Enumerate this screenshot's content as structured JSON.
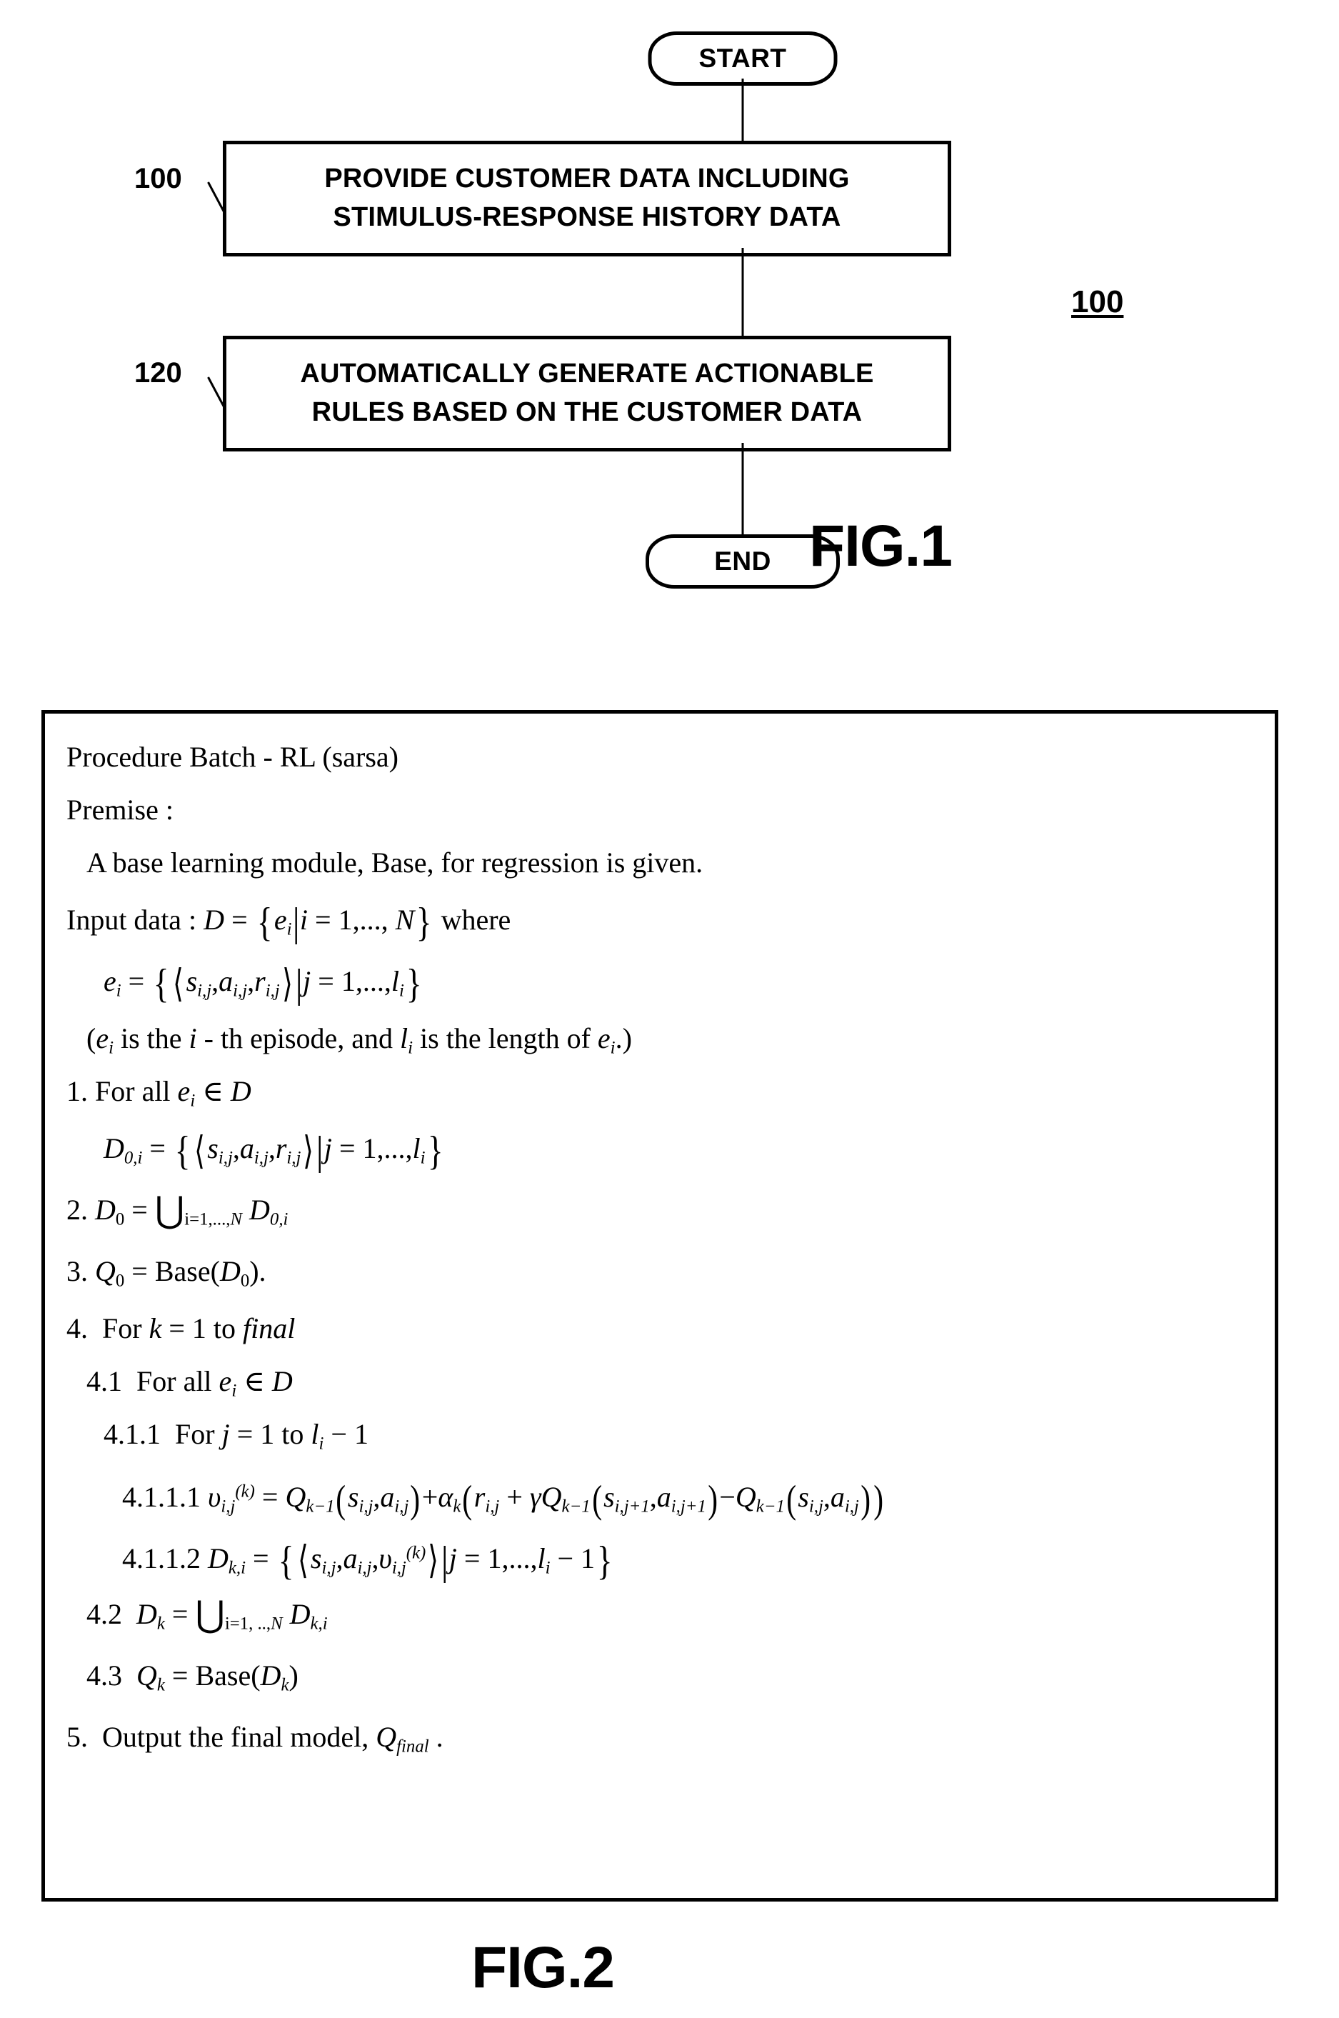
{
  "figure1": {
    "caption": "FIG.1",
    "overall_ref": "100",
    "start_terminal": "START",
    "end_terminal": "END",
    "steps": [
      {
        "ref": "100",
        "line1": "PROVIDE CUSTOMER DATA INCLUDING",
        "line2": "STIMULUS-RESPONSE HISTORY DATA"
      },
      {
        "ref": "120",
        "line1": "AUTOMATICALLY GENERATE ACTIONABLE",
        "line2": "RULES BASED ON THE CUSTOMER DATA"
      }
    ]
  },
  "figure2": {
    "caption": "FIG.2",
    "pseudocode": {
      "title": "Procedure Batch - RL (sarsa)",
      "premise_label": "Premise :",
      "premise_text": "A base learning module, Base, for regression is given.",
      "input_data_label": "Input data :",
      "input_data_set": "D = {e_i | i = 1,..., N} where",
      "episode_def": "e_i = {<s_i,j , a_i,j , r_i,j> | j = 1,..., l_i}",
      "episode_note": "(e_i is the i - th episode, and l_i is the length of e_i.)",
      "step_1": "1. For all e_i ∈ D",
      "step_1_body": "D_0,i = {<s_i,j , a_i,j , r_i,j> | j = 1,..., l_i}",
      "step_2": "2. D_0 = ∪_{i=1,...,N} D_0,i",
      "step_3": "3. Q_0 = Base(D_0).",
      "step_4": "4. For k = 1 to final",
      "step_4_1": "4.1 For all e_i ∈ D",
      "step_4_1_1": "4.1.1 For j = 1 to l_i - 1",
      "step_4_1_1_1": "4.1.1.1 v_i,j^(k) = Q_{k-1}(s_i,j , a_i,j) + α_k(r_i,j + γQ_{k-1}(s_i,j+1 , a_i,j+1) - Q_{k-1}(s_i,j , a_i,j))",
      "step_4_1_1_2": "4.1.1.2 D_k,i = {<s_i,j , a_i,j , v_i,j^(k)> | j = 1,..., l_i - 1}",
      "step_4_2": "4.2 D_k = ∪_{i=1, ..,N} D_k,i",
      "step_4_3": "4.3 Q_k = Base(D_k)",
      "step_5": "5. Output the final model, Q_final ."
    }
  },
  "colors": {
    "ink": "#000000",
    "paper": "#ffffff"
  }
}
